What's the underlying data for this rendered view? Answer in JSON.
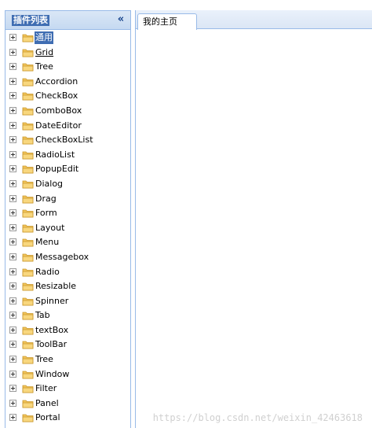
{
  "sidebar": {
    "title": "插件列表",
    "collapse_icon": "«",
    "items": [
      {
        "label": "通用",
        "selected": true
      },
      {
        "label": "Grid",
        "hover": true
      },
      {
        "label": "Tree"
      },
      {
        "label": "Accordion"
      },
      {
        "label": "CheckBox"
      },
      {
        "label": "ComboBox"
      },
      {
        "label": "DateEditor"
      },
      {
        "label": "CheckBoxList"
      },
      {
        "label": "RadioList"
      },
      {
        "label": "PopupEdit"
      },
      {
        "label": "Dialog"
      },
      {
        "label": "Drag"
      },
      {
        "label": "Form"
      },
      {
        "label": "Layout"
      },
      {
        "label": "Menu"
      },
      {
        "label": "Messagebox"
      },
      {
        "label": "Radio"
      },
      {
        "label": "Resizable"
      },
      {
        "label": "Spinner"
      },
      {
        "label": "Tab"
      },
      {
        "label": "textBox"
      },
      {
        "label": "ToolBar"
      },
      {
        "label": "Tree"
      },
      {
        "label": "Window"
      },
      {
        "label": "Filter"
      },
      {
        "label": "Panel"
      },
      {
        "label": "Portal"
      }
    ]
  },
  "tabs": [
    {
      "label": "我的主页"
    }
  ],
  "watermark": "https://blog.csdn.net/weixin_42463618",
  "colors": {
    "border": "#99bbe8",
    "selection": "#3f6db2",
    "folder": "#f2c45a"
  }
}
